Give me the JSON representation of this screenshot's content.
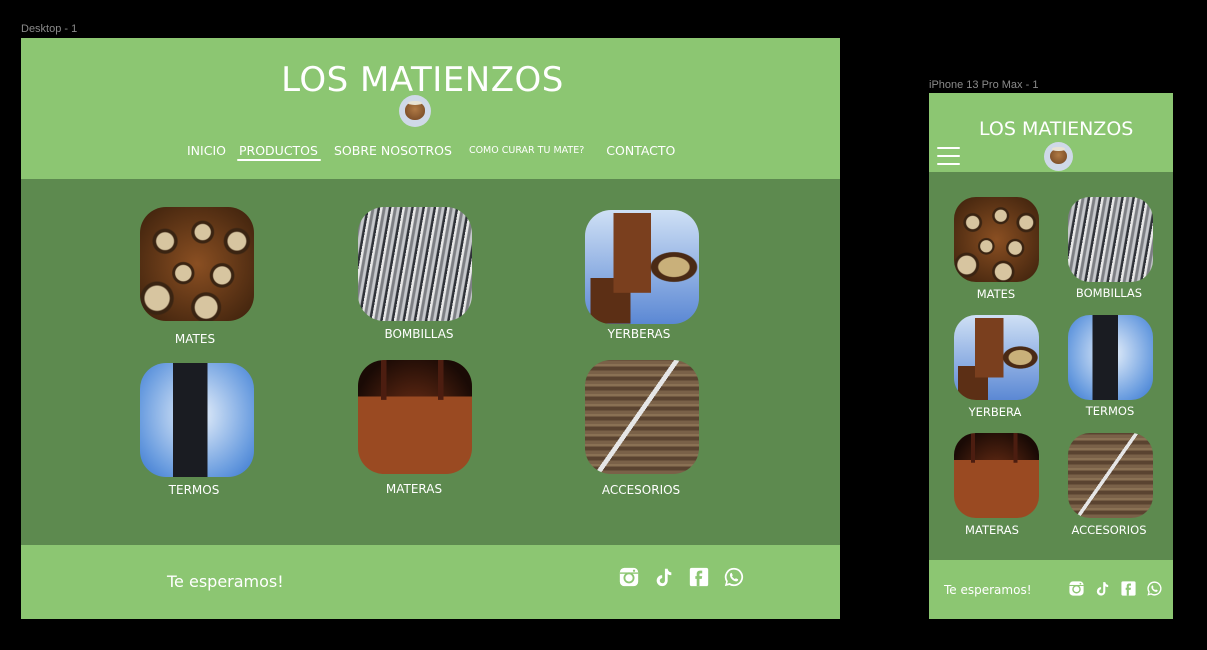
{
  "frames": {
    "desktop_label": "Desktop - 1",
    "mobile_label": "iPhone 13 Pro Max - 1"
  },
  "site": {
    "title": "LOS MATIENZOS",
    "logo_icon": "mate-gourd-icon"
  },
  "nav": {
    "inicio": "INICIO",
    "productos": "PRODUCTOS",
    "sobre": "SOBRE NOSOTROS",
    "curar": "COMO CURAR TU MATE?",
    "contacto": "CONTACTO",
    "active": "PRODUCTOS"
  },
  "desktop_products": [
    {
      "label": "MATES",
      "image": "mates"
    },
    {
      "label": "BOMBILLAS",
      "image": "bombillas"
    },
    {
      "label": "YERBERAS",
      "image": "yerberas"
    },
    {
      "label": "TERMOS",
      "image": "termos"
    },
    {
      "label": "MATERAS",
      "image": "materas"
    },
    {
      "label": "ACCESORIOS",
      "image": "accesorios"
    }
  ],
  "mobile_products": [
    {
      "label": "MATES",
      "image": "mates"
    },
    {
      "label": "BOMBILLAS",
      "image": "bombillas"
    },
    {
      "label": "YERBERA",
      "image": "yerberas"
    },
    {
      "label": "TERMOS",
      "image": "termos"
    },
    {
      "label": "MATERAS",
      "image": "materas"
    },
    {
      "label": "ACCESORIOS",
      "image": "accesorios"
    }
  ],
  "footer": {
    "text": "Te esperamos!",
    "social_icons": [
      "instagram-icon",
      "tiktok-icon",
      "facebook-icon",
      "whatsapp-icon"
    ]
  },
  "colors": {
    "header_green": "#8cc672",
    "body_green": "#5d8a4f",
    "background": "#000000"
  }
}
